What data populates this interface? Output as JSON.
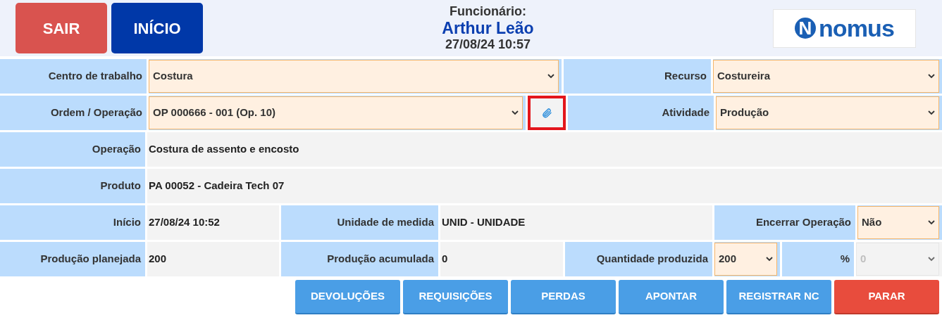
{
  "header": {
    "exit_button": "SAIR",
    "home_button": "INÍCIO",
    "employee_label": "Funcionário:",
    "employee_name": "Arthur Leão",
    "datetime": "27/08/24 10:57",
    "logo": {
      "mark": "N",
      "text": "nomus"
    }
  },
  "rows": [
    {
      "cells": [
        {
          "kind": "label",
          "text": "Centro de trabalho"
        },
        {
          "kind": "select",
          "value": "Costura",
          "disabled": false
        },
        {
          "kind": "label",
          "text": "Recurso"
        },
        {
          "kind": "select",
          "value": "Costureira",
          "disabled": false
        }
      ]
    },
    {
      "cells": [
        {
          "kind": "label",
          "text": "Ordem / Operação"
        },
        {
          "kind": "select",
          "value": "OP 000666 - 001 (Op. 10)",
          "disabled": false
        },
        {
          "kind": "attach",
          "highlighted": true
        },
        {
          "kind": "label",
          "text": "Atividade"
        },
        {
          "kind": "select",
          "value": "Produção",
          "disabled": false
        }
      ]
    },
    {
      "cells": [
        {
          "kind": "label",
          "text": "Operação"
        },
        {
          "kind": "text",
          "value": "Costura de assento e encosto"
        }
      ]
    },
    {
      "cells": [
        {
          "kind": "label",
          "text": "Produto"
        },
        {
          "kind": "text",
          "value": "PA 00052 - Cadeira Tech 07"
        }
      ]
    },
    {
      "cells": [
        {
          "kind": "label",
          "text": "Início"
        },
        {
          "kind": "text",
          "value": "27/08/24 10:52"
        },
        {
          "kind": "label",
          "text": "Unidade de medida"
        },
        {
          "kind": "text",
          "value": "UNID - UNIDADE"
        },
        {
          "kind": "label",
          "text": "Encerrar Operação"
        },
        {
          "kind": "select",
          "value": "Não",
          "disabled": false
        }
      ]
    },
    {
      "cells": [
        {
          "kind": "label",
          "text": "Produção planejada"
        },
        {
          "kind": "text",
          "value": "200"
        },
        {
          "kind": "label",
          "text": "Produção acumulada"
        },
        {
          "kind": "text",
          "value": "0"
        },
        {
          "kind": "label",
          "text": "Quantidade produzida"
        },
        {
          "kind": "select",
          "value": "200",
          "disabled": false
        },
        {
          "kind": "label",
          "text": "%"
        },
        {
          "kind": "select",
          "value": "0",
          "disabled": true
        }
      ]
    }
  ],
  "actions": [
    {
      "label": "DEVOLUÇÕES",
      "kind": "default"
    },
    {
      "label": "REQUISIÇÕES",
      "kind": "default"
    },
    {
      "label": "PERDAS",
      "kind": "default"
    },
    {
      "label": "APONTAR",
      "kind": "default"
    },
    {
      "label": "REGISTRAR NC",
      "kind": "default"
    },
    {
      "label": "PARAR",
      "kind": "danger"
    }
  ]
}
